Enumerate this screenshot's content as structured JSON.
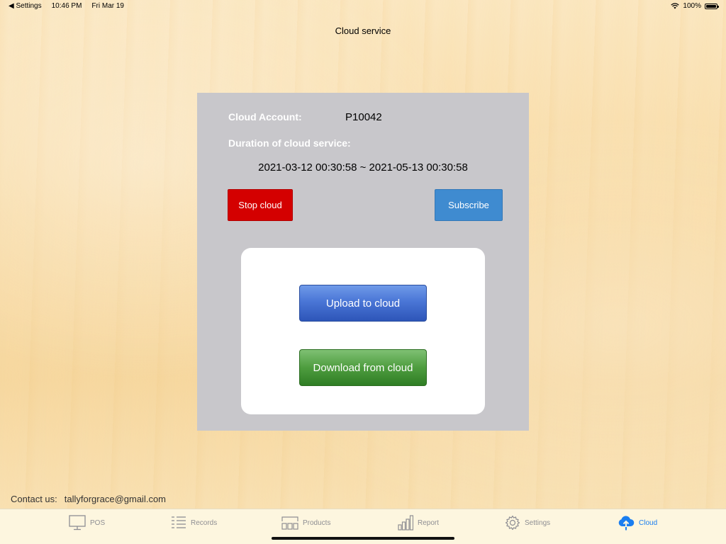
{
  "status_bar": {
    "back_label": "◀ Settings",
    "time": "10:46 PM",
    "date": "Fri Mar 19",
    "battery": "100%"
  },
  "nav": {
    "title": "Cloud service"
  },
  "panel": {
    "account_label": "Cloud Account:",
    "account_value": "P10042",
    "duration_label": "Duration of cloud service:",
    "duration_value": "2021-03-12 00:30:58 ~ 2021-05-13 00:30:58",
    "stop_label": "Stop cloud",
    "subscribe_label": "Subscribe",
    "upload_label": "Upload to cloud",
    "download_label": "Download from cloud"
  },
  "contact": {
    "label": "Contact us:",
    "email": "tallyforgrace@gmail.com"
  },
  "tabs": [
    {
      "label": "POS",
      "icon": "monitor-icon"
    },
    {
      "label": "Records",
      "icon": "list-icon"
    },
    {
      "label": "Products",
      "icon": "products-icon"
    },
    {
      "label": "Report",
      "icon": "bar-chart-icon"
    },
    {
      "label": "Settings",
      "icon": "gear-icon"
    },
    {
      "label": "Cloud",
      "icon": "cloud-upload-icon"
    }
  ],
  "colors": {
    "stop_button": "#d40000",
    "subscribe_button": "#3f8bd0",
    "active_tab": "#1a7ef0",
    "panel": "#c8c7cb"
  }
}
